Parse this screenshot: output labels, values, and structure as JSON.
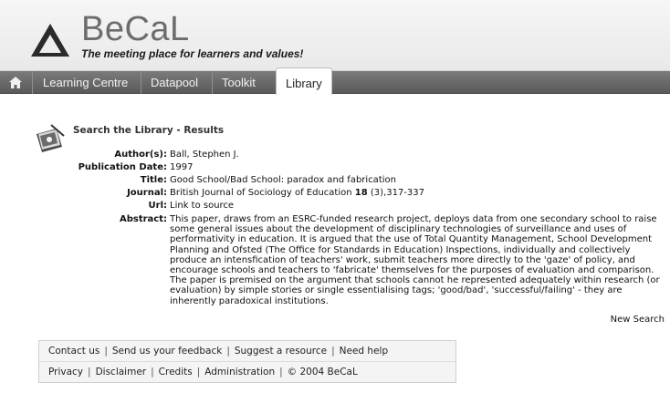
{
  "header": {
    "brand": "BeCaL",
    "tagline": "The meeting place for learners and values!"
  },
  "nav": {
    "tabs": [
      {
        "label": "Learning Centre"
      },
      {
        "label": "Datapool"
      },
      {
        "label": "Toolkit"
      },
      {
        "label": "Library",
        "active": true
      }
    ]
  },
  "results": {
    "title": "Search the Library - Results",
    "fields": {
      "author_label": "Author(s):",
      "author": "Ball, Stephen J.",
      "date_label": "Publication Date:",
      "date": "1997",
      "title_label": "Title:",
      "title": "Good School/Bad School: paradox and fabrication",
      "journal_label": "Journal:",
      "journal_name": "British Journal of Sociology of Education",
      "journal_volume": "18",
      "journal_pages": "(3),317-337",
      "url_label": "Url:",
      "url_link": "Link to source",
      "abstract_label": "Abstract:",
      "abstract": "This paper, draws from an ESRC-funded research project, deploys data from one secondary school to raise some general issues about the development of disciplinary technologies of surveillance and uses of performativity in education. It is argued that the use of Total Quantity Management, School Development Planning and Ofsted (The Office for Standards in Education) Inspections, individually and collectively produce an intensfication of teachers' work, submit teachers more directly to the 'gaze' of policy, and encourage schools and teachers to 'fabricate' themselves for the purposes of evaluation and comparison. The paper is premised on the argument that schools cannot he represented adequately within research (or evaluation) by simple stories or single essentialising tags; 'good/bad', 'successful/failing' - they are inherently paradoxical institutions."
    },
    "new_search": "New Search"
  },
  "footer": {
    "row1": [
      "Contact us",
      "Send us your feedback",
      "Suggest a resource",
      "Need help"
    ],
    "row2": [
      "Privacy",
      "Disclaimer",
      "Credits",
      "Administration",
      "© 2004 BeCaL"
    ]
  },
  "colors": {
    "nav_bg": "#666666",
    "header_bg": "#eeeeee",
    "logo_dark": "#2b2b2b"
  },
  "icons": {
    "home": "home-icon",
    "logo": "becal-logo-icon",
    "results": "book-search-icon"
  }
}
